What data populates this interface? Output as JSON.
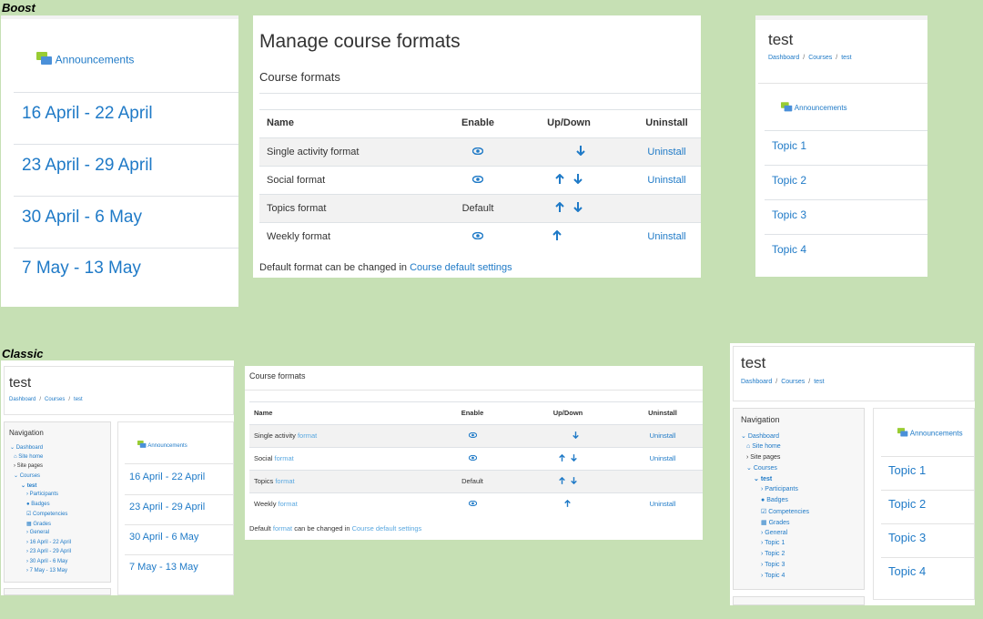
{
  "labels": {
    "boost": "Boost",
    "classic": "Classic"
  },
  "boost": {
    "weeks_panel": {
      "announcements": "Announcements",
      "weeks": [
        "16 April - 22 April",
        "23 April - 29 April",
        "30 April - 6 May",
        "7 May - 13 May"
      ]
    },
    "formats_panel": {
      "page_title": "Manage course formats",
      "section_title": "Course formats",
      "headers": [
        "Name",
        "Enable",
        "Up/Down",
        "Uninstall"
      ],
      "rows": [
        {
          "name": "Single activity format",
          "enable": "eye",
          "updown": [
            "down"
          ],
          "uninstall": "Uninstall"
        },
        {
          "name": "Social format",
          "enable": "eye",
          "updown": [
            "up",
            "down"
          ],
          "uninstall": "Uninstall"
        },
        {
          "name": "Topics format",
          "enable": "Default",
          "updown": [
            "up",
            "down"
          ],
          "uninstall": ""
        },
        {
          "name": "Weekly format",
          "enable": "eye",
          "updown": [
            "up"
          ],
          "uninstall": "Uninstall"
        }
      ],
      "footer_text": "Default format can be changed in",
      "footer_link": "Course default settings"
    },
    "topics_panel": {
      "title": "test",
      "breadcrumb": [
        "Dashboard",
        "Courses",
        "test"
      ],
      "announcements": "Announcements",
      "topics": [
        "Topic 1",
        "Topic 2",
        "Topic 3",
        "Topic 4"
      ]
    }
  },
  "classic": {
    "weeks_panel": {
      "title": "test",
      "breadcrumb": [
        "Dashboard",
        "Courses",
        "test"
      ],
      "nav_title": "Navigation",
      "nav": [
        "Dashboard",
        "Site home",
        "Site pages",
        "Courses",
        "test",
        "Participants",
        "Badges",
        "Competencies",
        "Grades",
        "General",
        "16 April - 22 April",
        "23 April - 29 April",
        "30 April - 6 May",
        "7 May - 13 May"
      ],
      "announcements": "Announcements",
      "weeks": [
        "16 April - 22 April",
        "23 April - 29 April",
        "30 April - 6 May",
        "7 May - 13 May"
      ]
    },
    "formats_panel": {
      "section_link": "Course formats",
      "headers": [
        "Name",
        "Enable",
        "Up/Down",
        "Uninstall"
      ],
      "rows": [
        {
          "name_pre": "Single activity ",
          "name_link": "format",
          "enable": "eye",
          "updown": [
            "down"
          ],
          "uninstall": "Uninstall"
        },
        {
          "name_pre": "Social ",
          "name_link": "format",
          "enable": "eye",
          "updown": [
            "up",
            "down"
          ],
          "uninstall": "Uninstall"
        },
        {
          "name_pre": "Topics ",
          "name_link": "format",
          "enable": "Default",
          "updown": [
            "up",
            "down"
          ],
          "uninstall": ""
        },
        {
          "name_pre": "Weekly ",
          "name_link": "format",
          "enable": "eye",
          "updown": [
            "up"
          ],
          "uninstall": "Uninstall"
        }
      ],
      "footer_pre": "Default ",
      "footer_link1": "format",
      "footer_mid": " can be changed in ",
      "footer_link2": "Course default settings"
    },
    "topics_panel": {
      "title": "test",
      "breadcrumb": [
        "Dashboard",
        "Courses",
        "test"
      ],
      "nav_title": "Navigation",
      "nav": [
        "Dashboard",
        "Site home",
        "Site pages",
        "Courses",
        "test",
        "Participants",
        "Badges",
        "Competencies",
        "Grades",
        "General",
        "Topic 1",
        "Topic 2",
        "Topic 3",
        "Topic 4"
      ],
      "announcements": "Announcements",
      "topics": [
        "Topic 1",
        "Topic 2",
        "Topic 3",
        "Topic 4"
      ]
    }
  },
  "colors": {
    "background": "#c6e0b4",
    "link": "#1f7ac7",
    "stripe": "#f2f2f2"
  }
}
